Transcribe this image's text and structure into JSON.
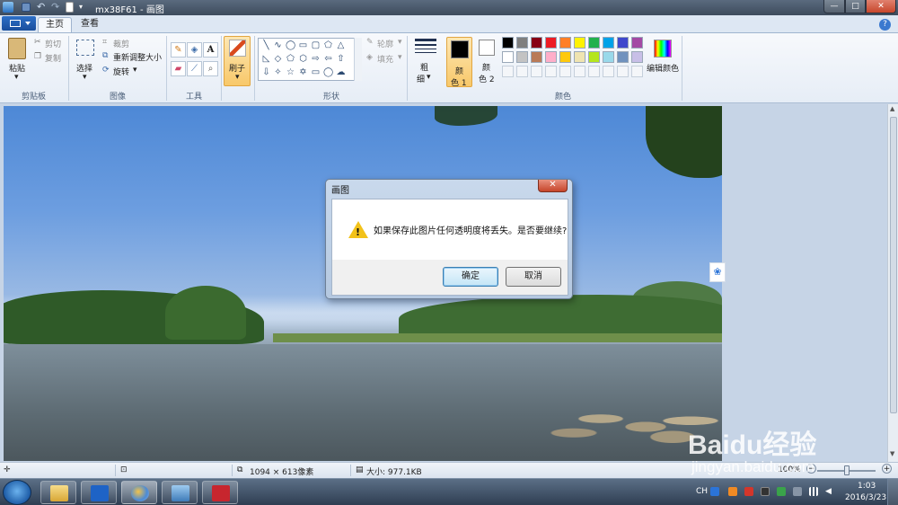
{
  "window": {
    "title": "mx38F61 - 画图",
    "controls": {
      "minimize": "—",
      "maximize": "□",
      "close": "✕"
    }
  },
  "tabs": [
    {
      "label": "主页",
      "active": true
    },
    {
      "label": "查看",
      "active": false
    }
  ],
  "help_label": "?",
  "ribbon": {
    "clipboard": {
      "paste": "粘贴",
      "cut": "剪切",
      "copy": "复制",
      "group": "剪贴板"
    },
    "image": {
      "select": "选择",
      "crop": "裁剪",
      "resize": "重新调整大小",
      "rotate": "旋转",
      "group": "图像"
    },
    "tools": {
      "text_tool": "A",
      "group": "工具"
    },
    "brushes": {
      "label": "刷子"
    },
    "shapes": {
      "outline": "轮廓",
      "fill": "填充",
      "group": "形状"
    },
    "size": {
      "label": "粗",
      "label2": "细"
    },
    "colors": {
      "color1_label": "颜色 1",
      "color1_top": "颜",
      "color1_bottom": "色 1",
      "color2_top": "颜",
      "color2_bottom": "色 2",
      "edit_colors": "编辑颜色",
      "group": "颜色",
      "palette_row1": [
        "#000000",
        "#7f7f7f",
        "#880015",
        "#ed1c24",
        "#ff7f27",
        "#fff200",
        "#22b14c",
        "#00a2e8",
        "#3f48cc",
        "#a349a4"
      ],
      "palette_row2": [
        "#ffffff",
        "#c3c3c3",
        "#b97a57",
        "#ffaec9",
        "#ffc90e",
        "#efe4b0",
        "#b5e61d",
        "#99d9ea",
        "#7092be",
        "#c8bfe7"
      ]
    }
  },
  "dialog": {
    "title": "画图",
    "close": "✕",
    "message": "如果保存此图片任何透明度将丢失。是否要继续?",
    "ok": "确定",
    "cancel": "取消"
  },
  "statusbar": {
    "dimensions": "1094 × 613像素",
    "size": "大小: 977.1KB",
    "zoom": "100%",
    "zoom_out": "−",
    "zoom_in": "+"
  },
  "taskbar": {
    "lang": "CH",
    "time": "1:03",
    "date": "2016/3/23"
  },
  "watermark": {
    "brand": "Baidu经验",
    "url": "jingyan.baidu.com"
  }
}
